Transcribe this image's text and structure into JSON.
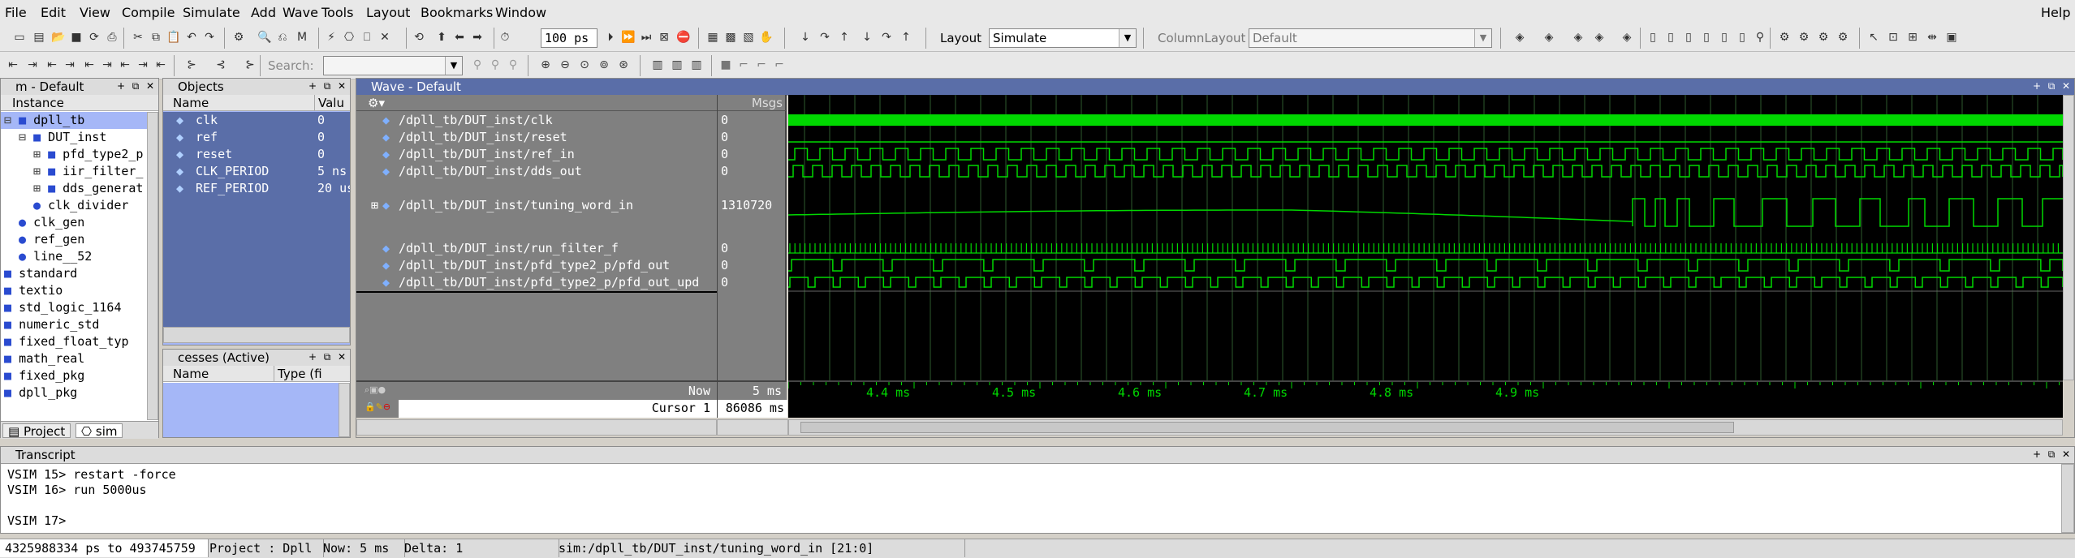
{
  "menu": [
    "File",
    "Edit",
    "View",
    "Compile",
    "Simulate",
    "Add",
    "Wave",
    "Tools",
    "Layout",
    "Bookmarks",
    "Window"
  ],
  "help": "Help",
  "toolbar": {
    "run_length": "100 ps",
    "layout_label": "Layout",
    "layout_value": "Simulate",
    "column_layout_label": "ColumnLayout",
    "column_layout_value": "Default",
    "search_label": "Search:"
  },
  "instance_panel": {
    "title": "m - Default",
    "column": "Instance",
    "items": [
      "dpll_tb",
      "DUT_inst",
      "pfd_type2_p",
      "iir_filter_",
      "dds_generat",
      "clk_divider",
      "clk_gen",
      "ref_gen",
      "line__52",
      "standard",
      "textio",
      "std_logic_1164",
      "numeric_std",
      "fixed_float_typ",
      "math_real",
      "fixed_pkg",
      "dpll_pkg"
    ],
    "tabs": [
      "Project",
      "sim"
    ]
  },
  "objects_panel": {
    "title": "Objects",
    "columns": [
      "Name",
      "Valu"
    ],
    "rows": [
      {
        "name": "clk",
        "value": "0"
      },
      {
        "name": "ref",
        "value": "0"
      },
      {
        "name": "reset",
        "value": "0"
      },
      {
        "name": "CLK_PERIOD",
        "value": "5 ns"
      },
      {
        "name": "REF_PERIOD",
        "value": "20 us"
      }
    ]
  },
  "processes_panel": {
    "title": "cesses (Active)",
    "columns": [
      "Name",
      "Type (fi"
    ]
  },
  "wave": {
    "title": "Wave - Default",
    "msgs_header": "Msgs",
    "signals": [
      {
        "path": "/dpll_tb/DUT_inst/clk",
        "value": "0"
      },
      {
        "path": "/dpll_tb/DUT_inst/reset",
        "value": "0"
      },
      {
        "path": "/dpll_tb/DUT_inst/ref_in",
        "value": "0"
      },
      {
        "path": "/dpll_tb/DUT_inst/dds_out",
        "value": "0"
      },
      {
        "path": "/dpll_tb/DUT_inst/tuning_word_in",
        "value": "1310720"
      },
      {
        "path": "/dpll_tb/DUT_inst/run_filter_f",
        "value": "0"
      },
      {
        "path": "/dpll_tb/DUT_inst/pfd_type2_p/pfd_out",
        "value": "0"
      },
      {
        "path": "/dpll_tb/DUT_inst/pfd_type2_p/pfd_out_upd",
        "value": "0"
      }
    ],
    "now_label": "Now",
    "now_value": "5 ms",
    "cursor_label": "Cursor 1",
    "cursor_value": "86086 ms",
    "time_ticks": [
      "4.4 ms",
      "4.5 ms",
      "4.6 ms",
      "4.7 ms",
      "4.8 ms",
      "4.9 ms"
    ],
    "colors": {
      "wave": "#00d800",
      "bg": "#000000",
      "grid": "#2e5a2e"
    }
  },
  "transcript": {
    "title": "Transcript",
    "lines": [
      "VSIM 15> restart -force",
      "VSIM 16> run 5000us",
      "",
      "VSIM 17>"
    ]
  },
  "status": {
    "range": "4325988334 ps to 493745759",
    "project": "Project : Dpll",
    "now": "Now: 5 ms",
    "delta": "Delta: 1",
    "signal": "sim:/dpll_tb/DUT_inst/tuning_word_in [21:0]"
  }
}
